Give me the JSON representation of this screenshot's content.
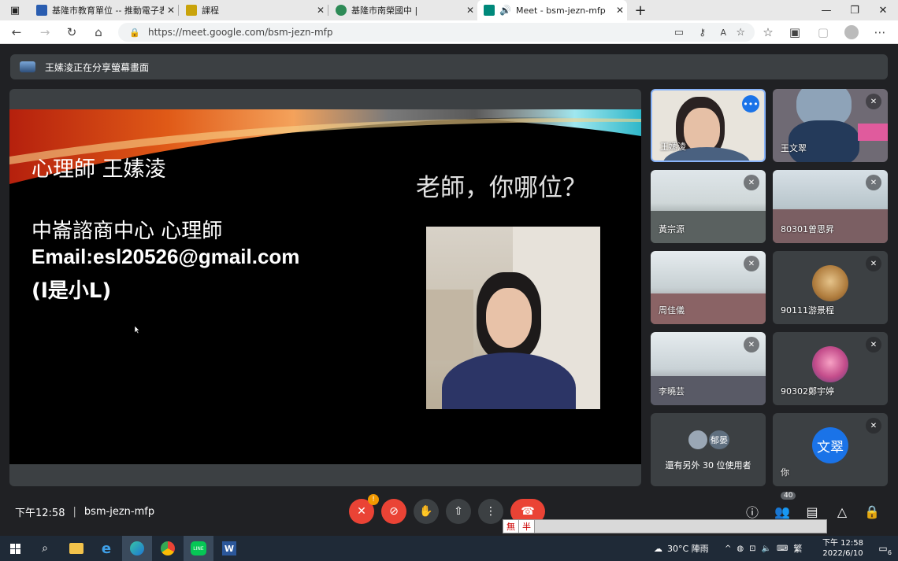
{
  "browser": {
    "tabs": [
      {
        "title": "基隆市教育單位 -- 推動電子表單",
        "icon_color": "#2a5db0"
      },
      {
        "title": "課程",
        "icon_color": "#c9a30a"
      },
      {
        "title": "基隆市南榮國中 |",
        "icon_color": "#2e8b57"
      },
      {
        "title": "Meet - bsm-jezn-mfp",
        "icon_color": "#00897b"
      }
    ],
    "url": "https://meet.google.com/bsm-jezn-mfp"
  },
  "meet": {
    "share_banner": "王嫊淩正在分享螢幕畫面",
    "slide": {
      "title": "心理師  王嫊淩",
      "question": "老師，你哪位？",
      "line1": "中崙諮商中心  心理師",
      "line2": "Email:esl20526@gmail.com",
      "line3": "(l是小L)"
    },
    "participants": [
      {
        "name": "王嫊淩",
        "has_video": true,
        "active": true
      },
      {
        "name": "王文翠",
        "has_video": true,
        "muted": true
      },
      {
        "name": "黃宗源",
        "has_video": true,
        "muted": true
      },
      {
        "name": "80301曾思昇",
        "has_video": true,
        "muted": true
      },
      {
        "name": "周佳儀",
        "has_video": true,
        "muted": true
      },
      {
        "name": "90111游景程",
        "has_video": false,
        "muted": true
      },
      {
        "name": "李曉芸",
        "has_video": true,
        "muted": true
      },
      {
        "name": "90302鄭宇婷",
        "has_video": false,
        "muted": true
      }
    ],
    "more_tile": {
      "avatar_label": "郁晏",
      "text": "還有另外 30 位使用者"
    },
    "self_tile": {
      "avatar_text": "文翠",
      "name": "你"
    },
    "bottom": {
      "time": "下午12:58",
      "meeting_code": "bsm-jezn-mfp",
      "participant_count": "40",
      "ime_chars": [
        "無",
        "半"
      ]
    }
  },
  "taskbar": {
    "weather": "30°C 陣雨",
    "ime_lang": "繁",
    "clock_time": "下午 12:58",
    "clock_date": "2022/6/10",
    "notif_count": "6"
  }
}
